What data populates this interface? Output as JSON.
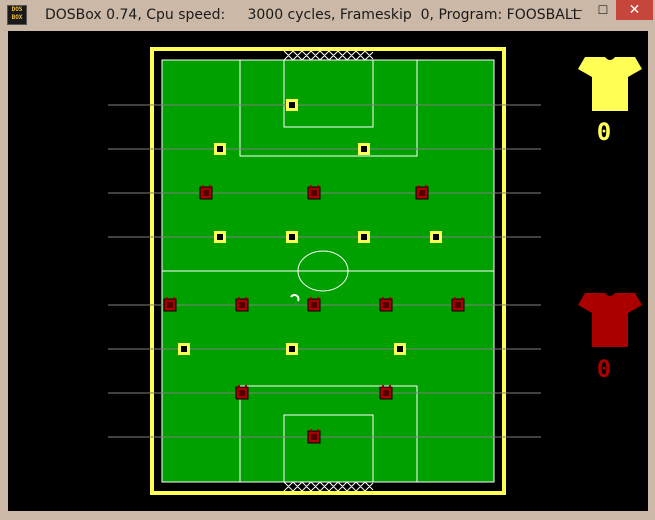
{
  "window": {
    "icon_label": "DOS BOX",
    "title": "DOSBox 0.74, Cpu speed:     3000 cycles, Frameskip  0, Program: FOOSBALL",
    "minimize_glyph": "—",
    "maximize_glyph": "☐",
    "close_glyph": "✕"
  },
  "colors": {
    "pitch": "#00a000",
    "border": "#ffff55",
    "yellow_team": "#ffff55",
    "red_team": "#aa0000",
    "lines": "#ffffff",
    "rods": "#808080"
  },
  "scoreboard": {
    "yellow_team": {
      "icon": "shirt-icon",
      "score": "0"
    },
    "red_team": {
      "icon": "shirt-icon",
      "score": "0"
    }
  },
  "rods": [
    {
      "team": "yellow",
      "players": 1
    },
    {
      "team": "yellow",
      "players": 2
    },
    {
      "team": "red",
      "players": 3
    },
    {
      "team": "yellow",
      "players": 4
    },
    {
      "team": "red",
      "players": 5
    },
    {
      "team": "yellow",
      "players": 3
    },
    {
      "team": "red",
      "players": 2
    },
    {
      "team": "red",
      "players": 1
    }
  ]
}
